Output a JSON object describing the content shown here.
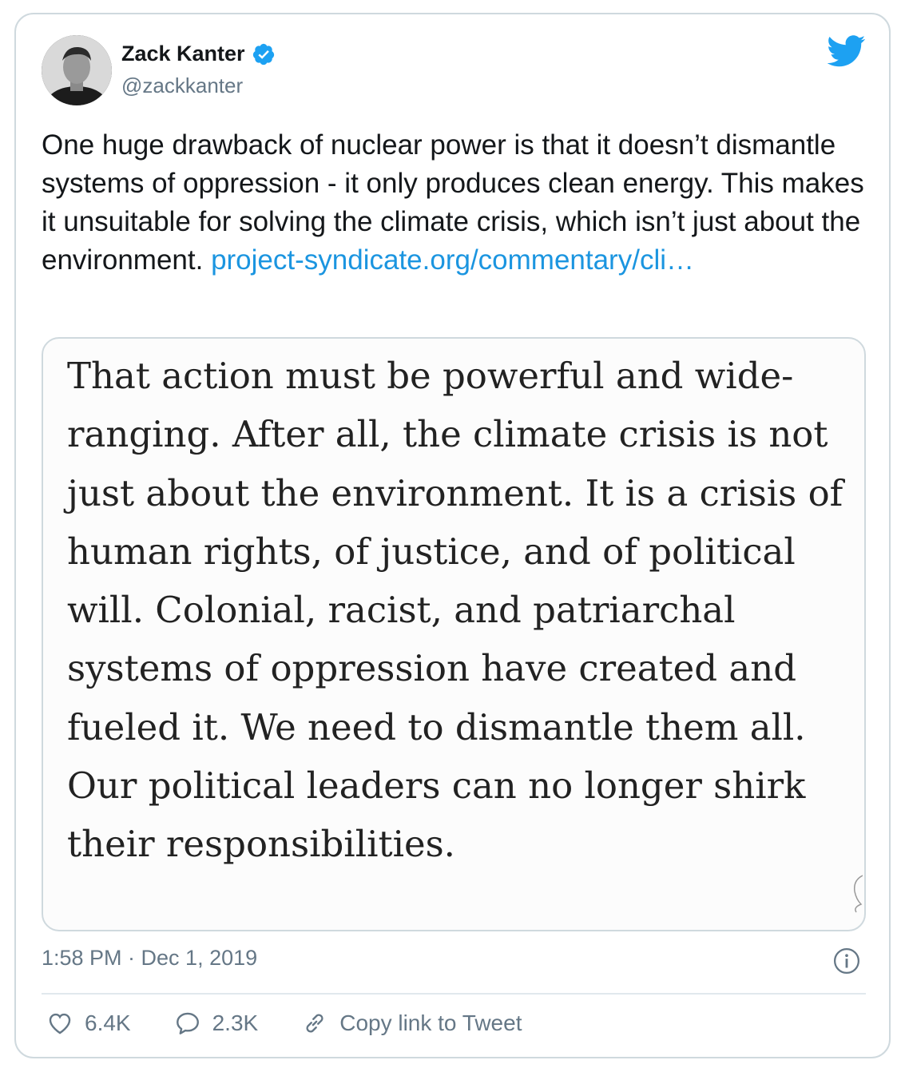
{
  "author": {
    "name": "Zack Kanter",
    "handle": "@zackkanter",
    "verified": true
  },
  "tweet": {
    "text": "One huge drawback of nuclear power is that it doesn’t dismantle systems of oppression - it only produces clean energy. This makes it unsuitable for solving the climate crisis, which isn’t just about the environment. ",
    "link_text": "project-syndicate.org/commentary/cli…"
  },
  "quote_image_text": "That action must be powerful and wide-ranging. After all, the climate crisis is not just about the environment. It is a crisis of human rights, of justice, and of political will. Colonial, racist, and patriarchal systems of oppression have created and fueled it. We need to dismantle them all. Our political leaders can no longer shirk their responsibilities.",
  "meta": {
    "timestamp": "1:58 PM · Dec 1, 2019"
  },
  "actions": {
    "likes": "6.4K",
    "replies": "2.3K",
    "copy_link": "Copy link to Tweet"
  },
  "icons": {
    "bird": "twitter-bird-icon",
    "verified": "verified-badge-icon",
    "info": "info-icon",
    "like": "heart-icon",
    "reply": "reply-bubble-icon",
    "link": "link-icon"
  },
  "colors": {
    "brand": "#1da1f2",
    "link": "#1b95e0",
    "muted": "#657786",
    "border": "#cfd9de"
  }
}
